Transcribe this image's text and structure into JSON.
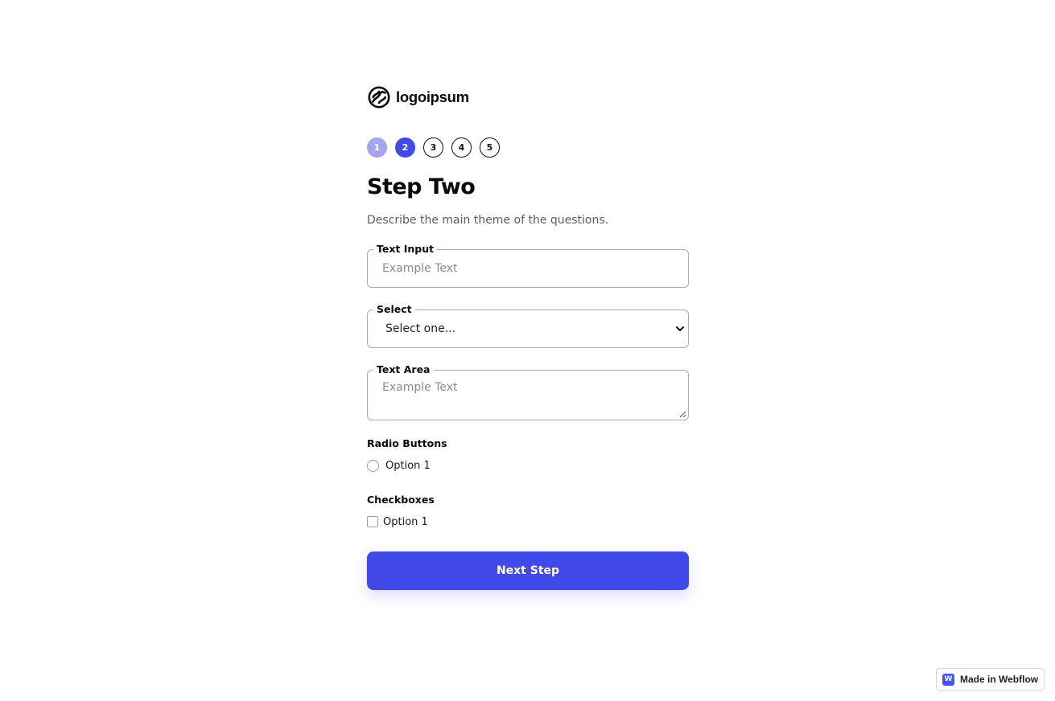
{
  "logo": {
    "text": "logoipsum",
    "icon": "logo-mark-icon"
  },
  "steps": [
    {
      "label": "1",
      "state": "done"
    },
    {
      "label": "2",
      "state": "active"
    },
    {
      "label": "3",
      "state": "upcoming"
    },
    {
      "label": "4",
      "state": "upcoming"
    },
    {
      "label": "5",
      "state": "upcoming"
    }
  ],
  "header": {
    "title": "Step Two",
    "subtitle": "Describe the main theme of the questions."
  },
  "fields": {
    "text_input": {
      "label": "Text Input",
      "placeholder": "Example Text"
    },
    "select": {
      "label": "Select",
      "value": "Select one..."
    },
    "text_area": {
      "label": "Text Area",
      "placeholder": "Example Text"
    }
  },
  "radio_group": {
    "label": "Radio Buttons",
    "options": [
      "Option 1"
    ]
  },
  "checkbox_group": {
    "label": "Checkboxes",
    "options": [
      "Option 1"
    ]
  },
  "actions": {
    "next_label": "Next Step"
  },
  "badge": {
    "icon_letter": "W",
    "text": "Made in Webflow"
  },
  "colors": {
    "accent": "#4149e8",
    "step_done": "#a5a4f1",
    "field_border": "#a8a6cc"
  }
}
